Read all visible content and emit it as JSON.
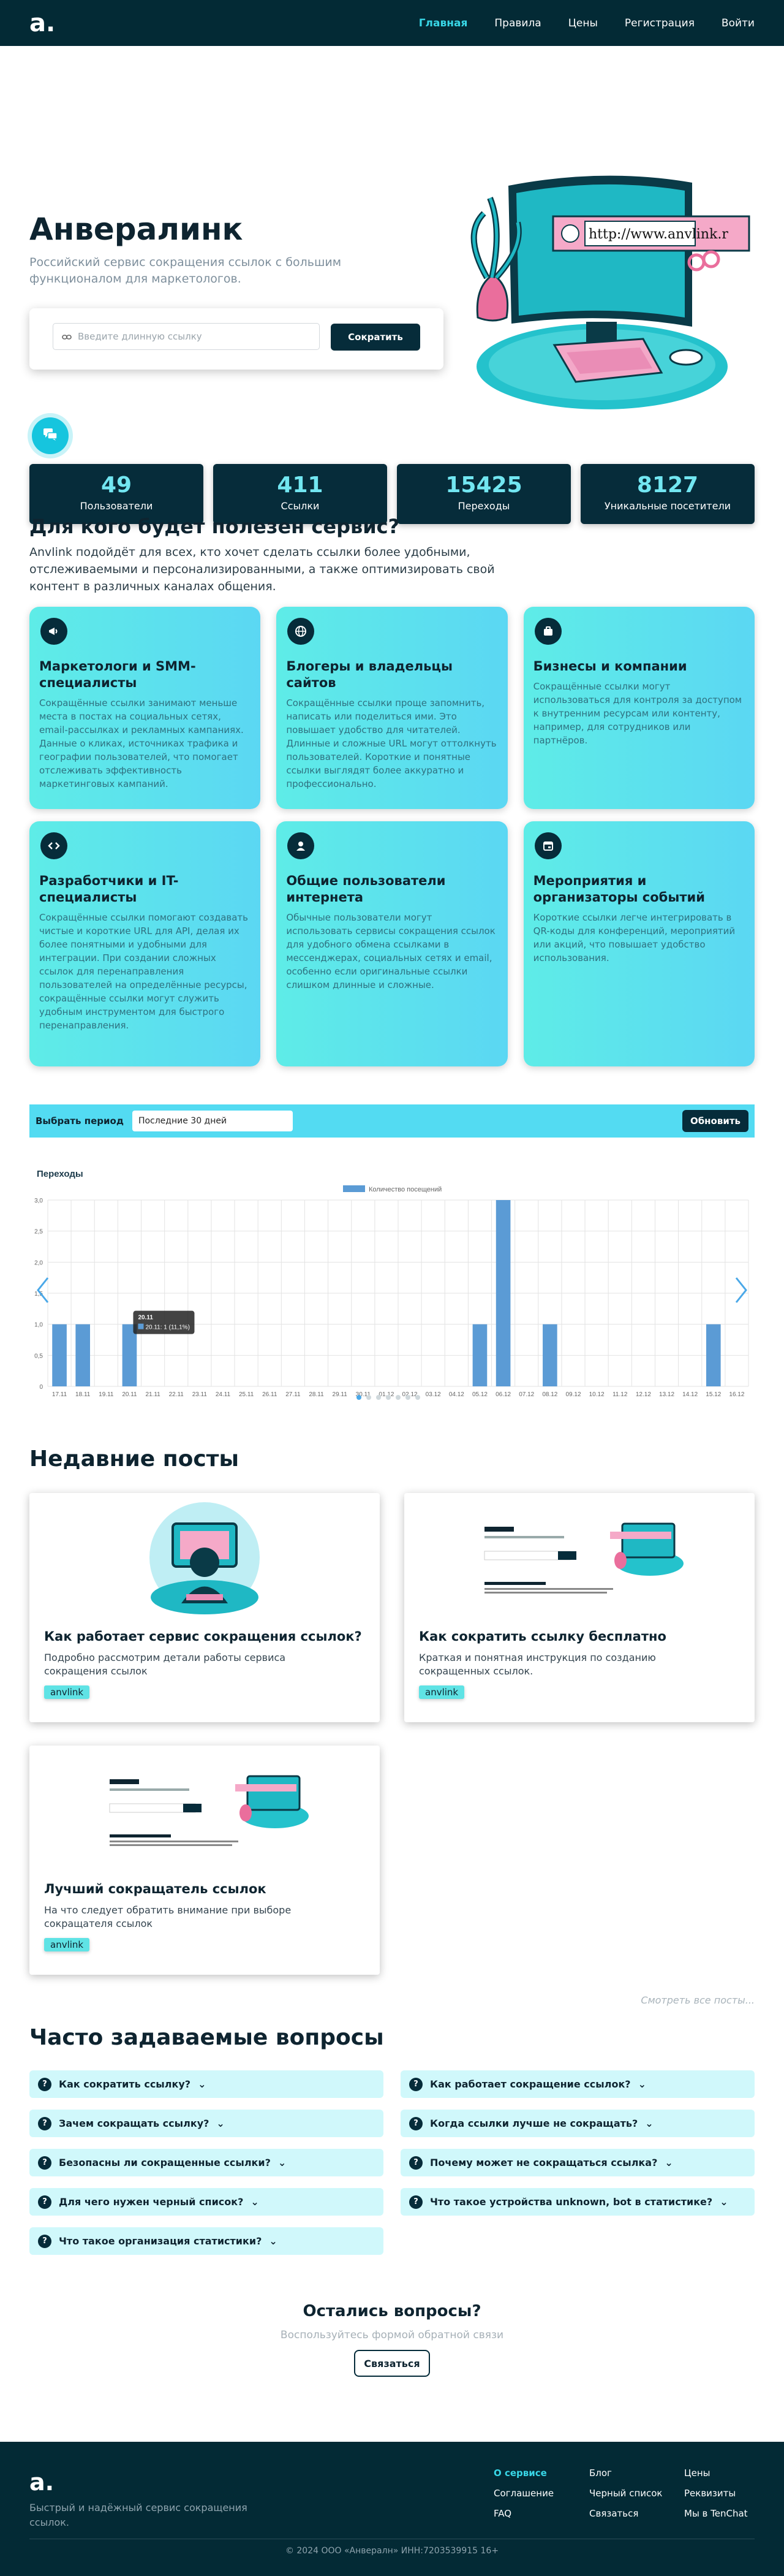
{
  "nav": {
    "brand": "a.",
    "items": [
      {
        "label": "Главная",
        "active": true
      },
      {
        "label": "Правила"
      },
      {
        "label": "Цены"
      },
      {
        "label": "Регистрация"
      },
      {
        "label": "Войти"
      }
    ]
  },
  "hero": {
    "title": "Анвералинк",
    "subtitle": "Российский сервис сокращения ссылок с большим функционалом для маркетологов.",
    "input_placeholder": "Введите длинную ссылку",
    "shorten_label": "Сократить",
    "illustration_url_text": "http://www.anvlink.r"
  },
  "stats": [
    {
      "value": "49",
      "label": "Пользователи"
    },
    {
      "value": "411",
      "label": "Ссылки"
    },
    {
      "value": "15425",
      "label": "Переходы"
    },
    {
      "value": "8127",
      "label": "Уникальные посетители"
    }
  ],
  "who": {
    "title": "Для кого будет полезен сервис?",
    "intro": "Anvlink подойдёт для всех, кто хочет сделать ссылки более удобными, отслеживаемыми и персонализированными, а также оптимизировать свой контент в различных каналах общения.",
    "cards": [
      {
        "icon": "megaphone-icon",
        "title": "Маркетологи и SMM-специалисты",
        "text": "Сокращённые ссылки занимают меньше места в постах на социальных сетях, email-рассылках и рекламных кампаниях. Данные о кликах, источниках трафика и географии пользователей, что помогает отслеживать эффективность маркетинговых кампаний."
      },
      {
        "icon": "globe-icon",
        "title": "Блогеры и владельцы сайтов",
        "text": "Сокращённые ссылки проще запомнить, написать или поделиться ими. Это повышает удобство для читателей. Длинные и сложные URL могут оттолкнуть пользователей. Короткие и понятные ссылки выглядят более аккуратно и профессионально."
      },
      {
        "icon": "briefcase-icon",
        "title": "Бизнесы и компании",
        "text": "Сокращённые ссылки могут использоваться для контроля за доступом к внутренним ресурсам или контенту, например, для сотрудников или партнёров."
      },
      {
        "icon": "code-icon",
        "title": "Разработчики и IT-специалисты",
        "text": "Сокращённые ссылки помогают создавать чистые и короткие URL для API, делая их более понятными и удобными для интеграции. При создании сложных ссылок для перенаправления пользователей на определённые ресурсы, сокращённые ссылки могут служить удобным инструментом для быстрого перенаправления."
      },
      {
        "icon": "user-icon",
        "title": "Общие пользователи интернета",
        "text": "Обычные пользователи могут использовать сервисы сокращения ссылок для удобного обмена ссылками в мессенджерах, социальных сетях и email, особенно если оригинальные ссылки слишком длинные и сложные."
      },
      {
        "icon": "calendar-icon",
        "title": "Мероприятия и организаторы событий",
        "text": "Короткие ссылки легче интегрировать в QR-коды для конференций, мероприятий или акций, что повышает удобство использования."
      }
    ]
  },
  "period": {
    "label": "Выбрать период",
    "selected": "Последние 30 дней",
    "update_label": "Обновить"
  },
  "chart_data": {
    "type": "bar",
    "title": "Переходы",
    "legend": [
      "Количество посещений"
    ],
    "legend_position": "top-center",
    "grid": true,
    "ylim": [
      0,
      3
    ],
    "yticks": [
      "0",
      "0,5",
      "1,0",
      "1,5",
      "2,0",
      "2,5",
      "3,0"
    ],
    "categories": [
      "17.11",
      "18.11",
      "19.11",
      "20.11",
      "21.11",
      "22.11",
      "23.11",
      "24.11",
      "25.11",
      "26.11",
      "27.11",
      "28.11",
      "29.11",
      "30.11",
      "01.12",
      "02.12",
      "03.12",
      "04.12",
      "05.12",
      "06.12",
      "07.12",
      "08.12",
      "09.12",
      "10.12",
      "11.12",
      "12.12",
      "13.12",
      "14.12",
      "15.12",
      "16.12"
    ],
    "series": [
      {
        "name": "Количество посещений",
        "color": "#5b9bd5",
        "values": [
          1,
          1,
          0,
          1,
          0,
          0,
          0,
          0,
          0,
          0,
          0,
          0,
          0,
          0,
          0,
          0,
          0,
          0,
          1,
          3,
          0,
          1,
          0,
          0,
          0,
          0,
          0,
          0,
          1,
          0
        ]
      }
    ],
    "tooltip": {
      "title": "20.11",
      "line": "20.11: 1 (11,1%)"
    }
  },
  "posts": {
    "title": "Недавние посты",
    "items": [
      {
        "title": "Как работает сервис сокращения ссылок?",
        "text": "Подробно рассмотрим детали работы сервиса сокращения ссылок",
        "tag": "anvlink",
        "img": "person"
      },
      {
        "title": "Как сократить ссылку бесплатно",
        "text": "Краткая и понятная инструкция по созданию сокращенных ссылок.",
        "tag": "anvlink",
        "img": "screenshot"
      },
      {
        "title": "Лучший сокращатель ссылок",
        "text": "На что следует обратить внимание при выборе сокращателя ссылок",
        "tag": "anvlink",
        "img": "screenshot"
      }
    ],
    "see_all": "Смотреть все посты..."
  },
  "faq": {
    "title": "Часто задаваемые вопросы",
    "items": [
      "Как сократить ссылку?",
      "Как работает сокращение ссылок?",
      "Зачем сокращать ссылку?",
      "Когда ссылки лучше не сокращать?",
      "Безопасны ли сокращенные ссылки?",
      "Почему может не сокращаться ссылка?",
      "Для чего нужен черный список?",
      "Что такое устройства unknown, bot в статистике?",
      "Что такое организация статистики?"
    ]
  },
  "contact": {
    "title": "Остались вопросы?",
    "subtitle": "Воспользуйтесь формой обратной связи",
    "button": "Связаться"
  },
  "footer": {
    "brand": "a.",
    "tagline": "Быстрый и надёжный сервис сокращения ссылок.",
    "cols": [
      [
        "О сервисе",
        "Соглашение",
        "FAQ"
      ],
      [
        "Блог",
        "Черный список",
        "Связаться"
      ],
      [
        "Цены",
        "Реквизиты",
        "Мы в TenChat"
      ]
    ],
    "copyright": "© 2024 ООО «Анвералн» ИНН:7203539915 16+"
  }
}
